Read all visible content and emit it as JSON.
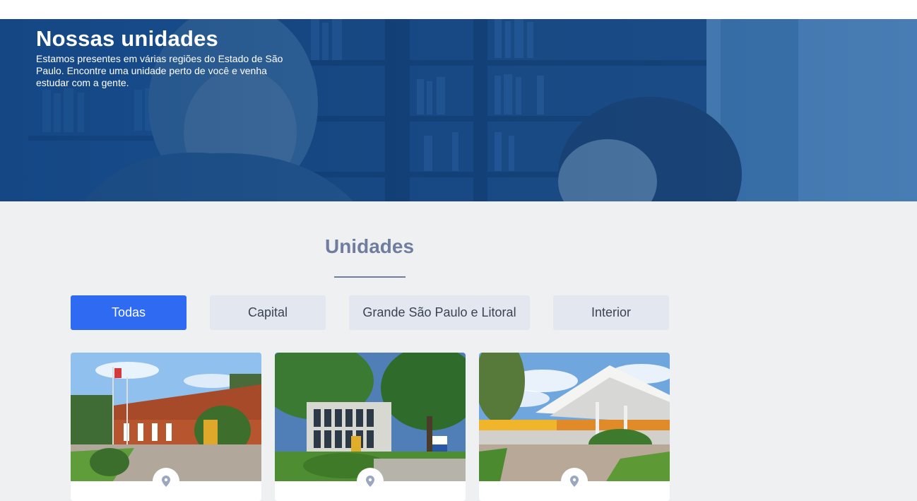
{
  "hero": {
    "title": "Nossas unidades",
    "subtitle": "Estamos presentes em várias regiões do Estado de São Paulo. Encontre uma unidade perto de você e venha estudar com a gente."
  },
  "section": {
    "title": "Unidades"
  },
  "tabs": [
    {
      "label": "Todas",
      "active": true
    },
    {
      "label": "Capital",
      "active": false
    },
    {
      "label": "Grande São Paulo e Litoral",
      "active": false
    },
    {
      "label": "Interior",
      "active": false
    }
  ],
  "cards": [
    {
      "image": "campus-brick-building-with-flags",
      "icon": "map-pin-icon"
    },
    {
      "image": "campus-glass-building-with-trees",
      "icon": "map-pin-icon"
    },
    {
      "image": "campus-modern-canopy-building",
      "icon": "map-pin-icon"
    }
  ],
  "colors": {
    "accent": "#2f6bf2",
    "hero_blue": "#1e5896",
    "section_title": "#6f7e9e",
    "tab_inactive": "#e3e7ef",
    "page_bg": "#eff0f2",
    "pin": "#9aa7bf"
  }
}
